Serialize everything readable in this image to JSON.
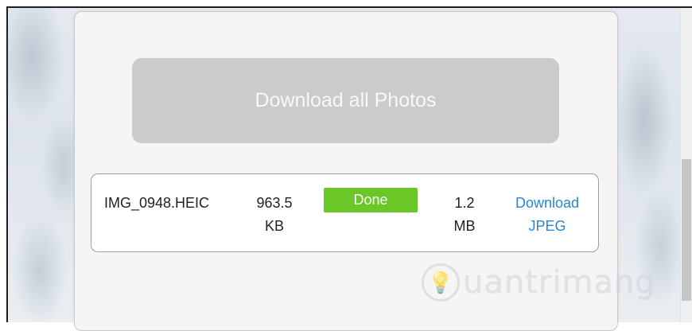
{
  "actions": {
    "download_all_label": "Download all Photos"
  },
  "file": {
    "name": "IMG_0948.HEIC",
    "original_size_value": "963.5",
    "original_size_unit": "KB",
    "status": "Done",
    "converted_size_value": "1.2",
    "converted_size_unit": "MB",
    "download_label_line1": "Download",
    "download_label_line2": "JPEG"
  },
  "watermark": {
    "text": "uantrimang",
    "icon": "lightbulb-icon"
  },
  "colors": {
    "status_done": "#6bc627",
    "link": "#2a86d8",
    "button_disabled": "#cbcbcb"
  }
}
